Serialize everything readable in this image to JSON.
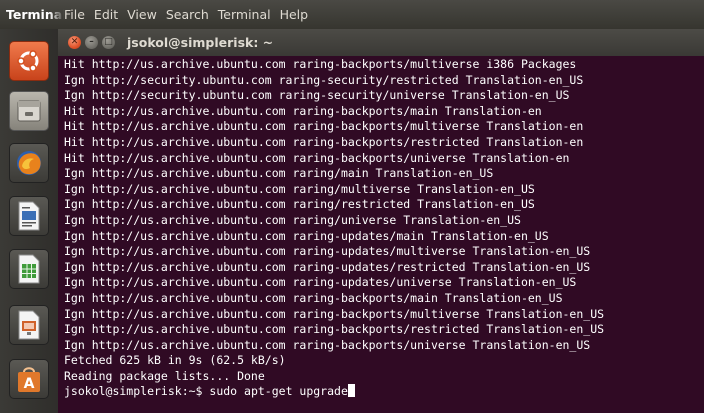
{
  "menubar": {
    "app_name": "Terminal",
    "items": [
      "File",
      "Edit",
      "View",
      "Search",
      "Terminal",
      "Help"
    ]
  },
  "launcher": {
    "items": [
      {
        "name": "ubuntu-dash-icon",
        "color": "#e05a2b"
      },
      {
        "name": "files-icon",
        "color": "#9b9890"
      },
      {
        "name": "firefox-icon",
        "color": "#e8821c"
      },
      {
        "name": "writer-icon",
        "color": "#3b6fb6"
      },
      {
        "name": "calc-icon",
        "color": "#3f9b3a"
      },
      {
        "name": "impress-icon",
        "color": "#d0622b"
      },
      {
        "name": "software-center-icon",
        "color": "#e0782b"
      }
    ]
  },
  "window": {
    "title": "jsokol@simplerisk: ~"
  },
  "terminal": {
    "lines": [
      "Hit http://us.archive.ubuntu.com raring-backports/multiverse i386 Packages",
      "Ign http://security.ubuntu.com raring-security/restricted Translation-en_US",
      "Ign http://security.ubuntu.com raring-security/universe Translation-en_US",
      "Hit http://us.archive.ubuntu.com raring-backports/main Translation-en",
      "Hit http://us.archive.ubuntu.com raring-backports/multiverse Translation-en",
      "Hit http://us.archive.ubuntu.com raring-backports/restricted Translation-en",
      "Hit http://us.archive.ubuntu.com raring-backports/universe Translation-en",
      "Ign http://us.archive.ubuntu.com raring/main Translation-en_US",
      "Ign http://us.archive.ubuntu.com raring/multiverse Translation-en_US",
      "Ign http://us.archive.ubuntu.com raring/restricted Translation-en_US",
      "Ign http://us.archive.ubuntu.com raring/universe Translation-en_US",
      "Ign http://us.archive.ubuntu.com raring-updates/main Translation-en_US",
      "Ign http://us.archive.ubuntu.com raring-updates/multiverse Translation-en_US",
      "Ign http://us.archive.ubuntu.com raring-updates/restricted Translation-en_US",
      "Ign http://us.archive.ubuntu.com raring-updates/universe Translation-en_US",
      "Ign http://us.archive.ubuntu.com raring-backports/main Translation-en_US",
      "Ign http://us.archive.ubuntu.com raring-backports/multiverse Translation-en_US",
      "Ign http://us.archive.ubuntu.com raring-backports/restricted Translation-en_US",
      "Ign http://us.archive.ubuntu.com raring-backports/universe Translation-en_US",
      "Fetched 625 kB in 9s (62.5 kB/s)",
      "Reading package lists... Done"
    ],
    "prompt": "jsokol@simplerisk:~$ ",
    "command": "sudo apt-get upgrade"
  },
  "colors": {
    "terminal_bg": "#300a24",
    "terminal_fg": "#ffffff",
    "accent": "#e0532a"
  }
}
